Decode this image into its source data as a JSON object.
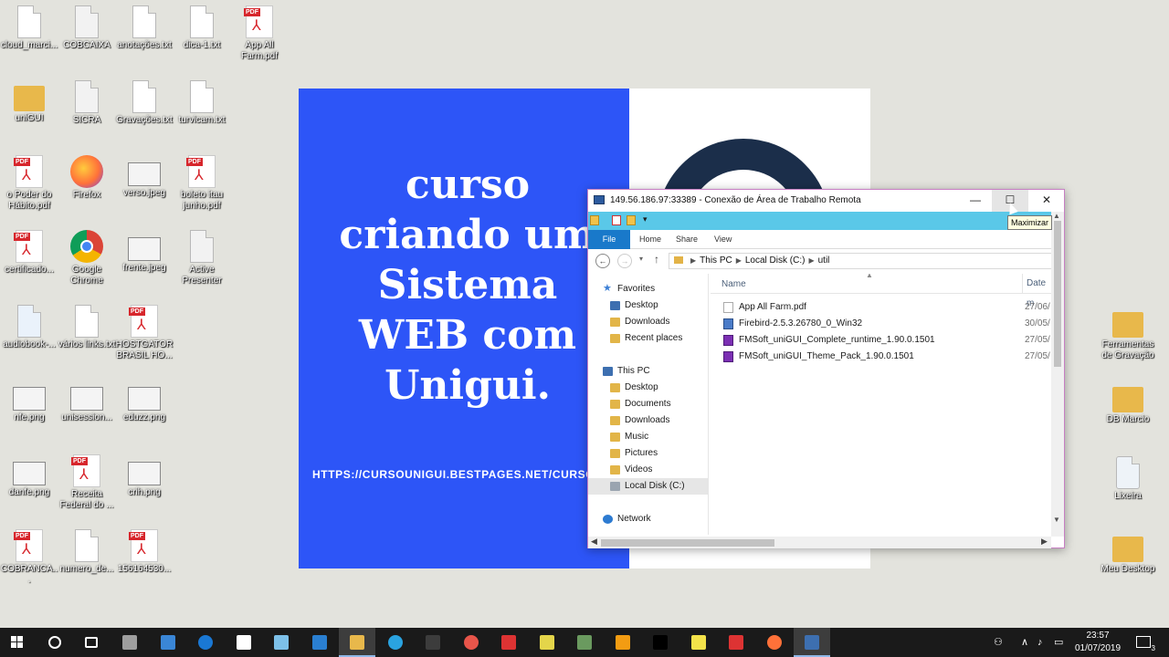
{
  "desktop": {
    "icons_left": [
      {
        "label": "cloud_marci...",
        "kind": "doc"
      },
      {
        "label": "COBCAIXA",
        "kind": "app"
      },
      {
        "label": "anotações.txt",
        "kind": "doc"
      },
      {
        "label": "dica-1.txt",
        "kind": "doc"
      },
      {
        "label": "App All Farm.pdf",
        "kind": "pdf"
      },
      {
        "label": "uniGUI",
        "kind": "folder"
      },
      {
        "label": "SICRA",
        "kind": "app"
      },
      {
        "label": "Gravações.txt",
        "kind": "doc"
      },
      {
        "label": "turvicam.txt",
        "kind": "doc"
      },
      {
        "label": "o Poder do Hábito.pdf",
        "kind": "pdf"
      },
      {
        "label": "Firefox",
        "kind": "firefox"
      },
      {
        "label": "verso.jpeg",
        "kind": "image"
      },
      {
        "label": "boleto itau junho.pdf",
        "kind": "pdf"
      },
      {
        "label": "certificado...",
        "kind": "pdf"
      },
      {
        "label": "Google Chrome",
        "kind": "chrome"
      },
      {
        "label": "frente.jpeg",
        "kind": "image"
      },
      {
        "label": "Active Presenter",
        "kind": "app"
      },
      {
        "label": "audiobook-...",
        "kind": "mp3"
      },
      {
        "label": "vários links.txt",
        "kind": "doc"
      },
      {
        "label": "HOSTGATOR BRASIL HO...",
        "kind": "pdf"
      },
      {
        "label": "nfe.png",
        "kind": "image"
      },
      {
        "label": "unisession...",
        "kind": "image"
      },
      {
        "label": "eduzz.png",
        "kind": "image"
      },
      {
        "label": "danfe.png",
        "kind": "image"
      },
      {
        "label": "Receita Federal do ...",
        "kind": "pdf"
      },
      {
        "label": "crih.png",
        "kind": "image"
      },
      {
        "label": "COBRANCA...",
        "kind": "pdf"
      },
      {
        "label": "numero_de...",
        "kind": "doc"
      },
      {
        "label": "156164530...",
        "kind": "pdf"
      }
    ],
    "icons_right": [
      {
        "label": "Ferramentas de Gravação",
        "kind": "folder"
      },
      {
        "label": "DB Marcio",
        "kind": "folder"
      },
      {
        "label": "Lixeira",
        "kind": "recycle"
      },
      {
        "label": "Meu Desktop",
        "kind": "folder"
      }
    ]
  },
  "slide": {
    "title_lines": [
      "curso",
      "criando um",
      "Sistema",
      "WEB com",
      "Unigui."
    ],
    "url": "HTTPS://CURSOUNIGUI.BESTPAGES.NET/CURSOU"
  },
  "remote_window": {
    "title": "149.56.186.97:33389 - Conexão de Área de Trabalho Remota",
    "minimize_glyph": "—",
    "maximize_glyph": "☐",
    "close_glyph": "✕",
    "tooltip": "Maximizar",
    "ribbon_tabs": [
      "File",
      "Home",
      "Share",
      "View"
    ],
    "address": [
      "This PC",
      "Local Disk (C:)",
      "util"
    ],
    "nav_pane": {
      "favorites_label": "Favorites",
      "favorites": [
        "Desktop",
        "Downloads",
        "Recent places"
      ],
      "thispc_label": "This PC",
      "thispc": [
        "Desktop",
        "Documents",
        "Downloads",
        "Music",
        "Pictures",
        "Videos",
        "Local Disk (C:)"
      ],
      "network_label": "Network"
    },
    "columns": {
      "name": "Name",
      "date": "Date m"
    },
    "files": [
      {
        "name": "App All Farm.pdf",
        "date": "27/06/",
        "type": "pdf"
      },
      {
        "name": "Firebird-2.5.3.26780_0_Win32",
        "date": "30/05/",
        "type": "exe"
      },
      {
        "name": "FMSoft_uniGUI_Complete_runtime_1.90.0.1501",
        "date": "27/05/",
        "type": "pkg"
      },
      {
        "name": "FMSoft_uniGUI_Theme_Pack_1.90.0.1501",
        "date": "27/05/",
        "type": "pkg"
      }
    ]
  },
  "taskbar": {
    "apps": [
      "start",
      "search",
      "task-view",
      "calculator",
      "store",
      "edge",
      "mail",
      "notepad",
      "vscode",
      "file-explorer",
      "telegram",
      "slack",
      "opera",
      "devexpress",
      "delphi",
      "notepad2",
      "sublime",
      "terminal",
      "sticky-notes",
      "devexpress2",
      "firefox",
      "remote-desktop"
    ],
    "tray_icons": [
      "people",
      "chevron-up",
      "volume",
      "network"
    ],
    "time": "23:57",
    "date": "01/07/2019",
    "notification_count": "3"
  },
  "colors": {
    "slide_blue": "#2d55f7",
    "title_bar_accent": "#5ac8e8",
    "file_tab_blue": "#1979ca",
    "window_border": "#c77fc3"
  }
}
